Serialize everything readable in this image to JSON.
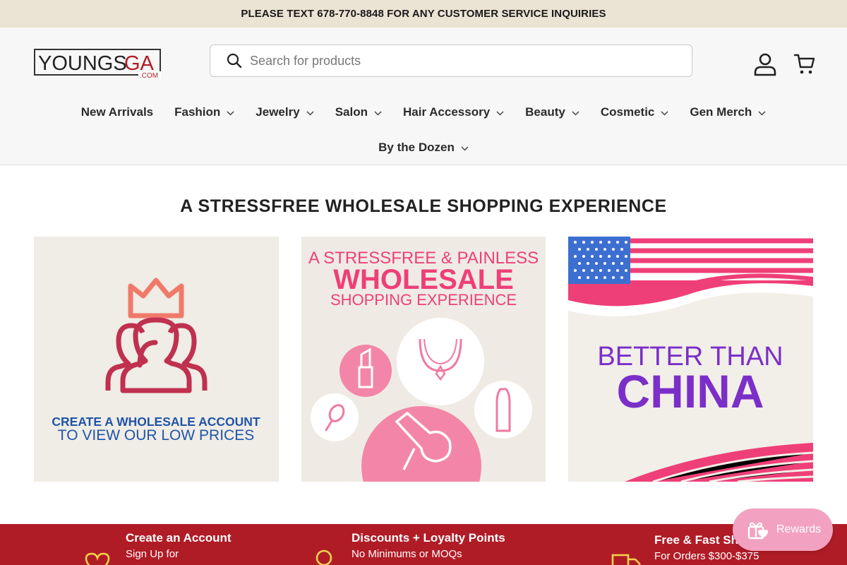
{
  "announcement": "PLEASE TEXT 678-770-8848 FOR ANY CUSTOMER SERVICE INQUIRIES",
  "logo": {
    "text_main": "YOUNGS",
    "text_accent": "GA",
    "text_suffix": ".COM"
  },
  "search": {
    "placeholder": "Search for products",
    "icon": "search-icon"
  },
  "header_icons": {
    "account": "account-icon",
    "cart": "cart-icon"
  },
  "nav": {
    "row1": [
      {
        "label": "New Arrivals",
        "dropdown": false
      },
      {
        "label": "Fashion",
        "dropdown": true
      },
      {
        "label": "Jewelry",
        "dropdown": true
      },
      {
        "label": "Salon",
        "dropdown": true
      },
      {
        "label": "Hair Accessory",
        "dropdown": true
      },
      {
        "label": "Beauty",
        "dropdown": true
      },
      {
        "label": "Cosmetic",
        "dropdown": true
      },
      {
        "label": "Gen Merch",
        "dropdown": true
      }
    ],
    "row2": [
      {
        "label": "By the Dozen",
        "dropdown": true
      }
    ]
  },
  "headline": "A STRESSFREE WHOLESALE SHOPPING EXPERIENCE",
  "tiles": {
    "account": {
      "line1": "CREATE A WHOLESALE ACCOUNT",
      "line2": "TO VIEW OUR LOW PRICES"
    },
    "wholesale": {
      "line1": "A STRESSFREE & PAINLESS",
      "line2": "WHOLESALE",
      "line3": "SHOPPING EXPERIENCE"
    },
    "china": {
      "line1": "BETTER THAN",
      "line2": "CHINA"
    }
  },
  "benefits": [
    {
      "title": "Create an Account",
      "subtitle": "Sign Up for",
      "icon": "heart-icon"
    },
    {
      "title": "Discounts + Loyalty Points",
      "subtitle": "No Minimums or MOQs",
      "icon": "pin-icon"
    },
    {
      "title": "Free & Fast Ship",
      "subtitle": "For Orders $300-$375",
      "icon": "truck-icon"
    }
  ],
  "rewards": {
    "label": "Rewards",
    "icon": "gift-heart-icon"
  },
  "colors": {
    "brand_red": "#b01c26",
    "announce_bg": "#ebe3d3",
    "rewards_pink": "#f2a2c0",
    "accent_pink": "#ef3f78",
    "purple": "#7b2fc9"
  }
}
